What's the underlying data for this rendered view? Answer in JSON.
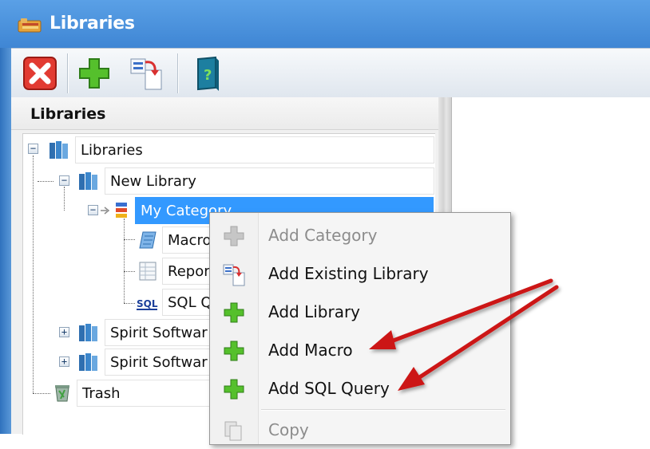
{
  "window": {
    "title": "Libraries"
  },
  "toolbar": {
    "buttons": [
      "close-red-x-icon",
      "add-green-plus-icon",
      "add-existing-library-icon",
      "help-book-icon"
    ]
  },
  "panel": {
    "title": "Libraries"
  },
  "tree": {
    "root": "Libraries",
    "new_library": "New Library",
    "my_category": "My Category",
    "macros": "Macro",
    "reports": "Repor",
    "sql": "SQL Q",
    "spirit1": "Spirit Softwar",
    "spirit2": "Spirit Softwar",
    "trash": "Trash"
  },
  "context_menu": {
    "items": [
      {
        "label": "Add Category",
        "enabled": false,
        "icon": "plus-gray-icon"
      },
      {
        "label": "Add Existing Library",
        "enabled": true,
        "icon": "add-existing-library-icon"
      },
      {
        "label": "Add Library",
        "enabled": true,
        "icon": "plus-green-icon"
      },
      {
        "label": "Add Macro",
        "enabled": true,
        "icon": "plus-green-icon"
      },
      {
        "label": "Add SQL Query",
        "enabled": true,
        "icon": "plus-green-icon"
      },
      {
        "label": "Copy",
        "enabled": false,
        "icon": "copy-gray-icon"
      }
    ]
  },
  "colors": {
    "titlebar": "#4a92dd",
    "selection": "#3399ff",
    "arrow": "#cc1414",
    "plus_green": "#4fb82a"
  }
}
